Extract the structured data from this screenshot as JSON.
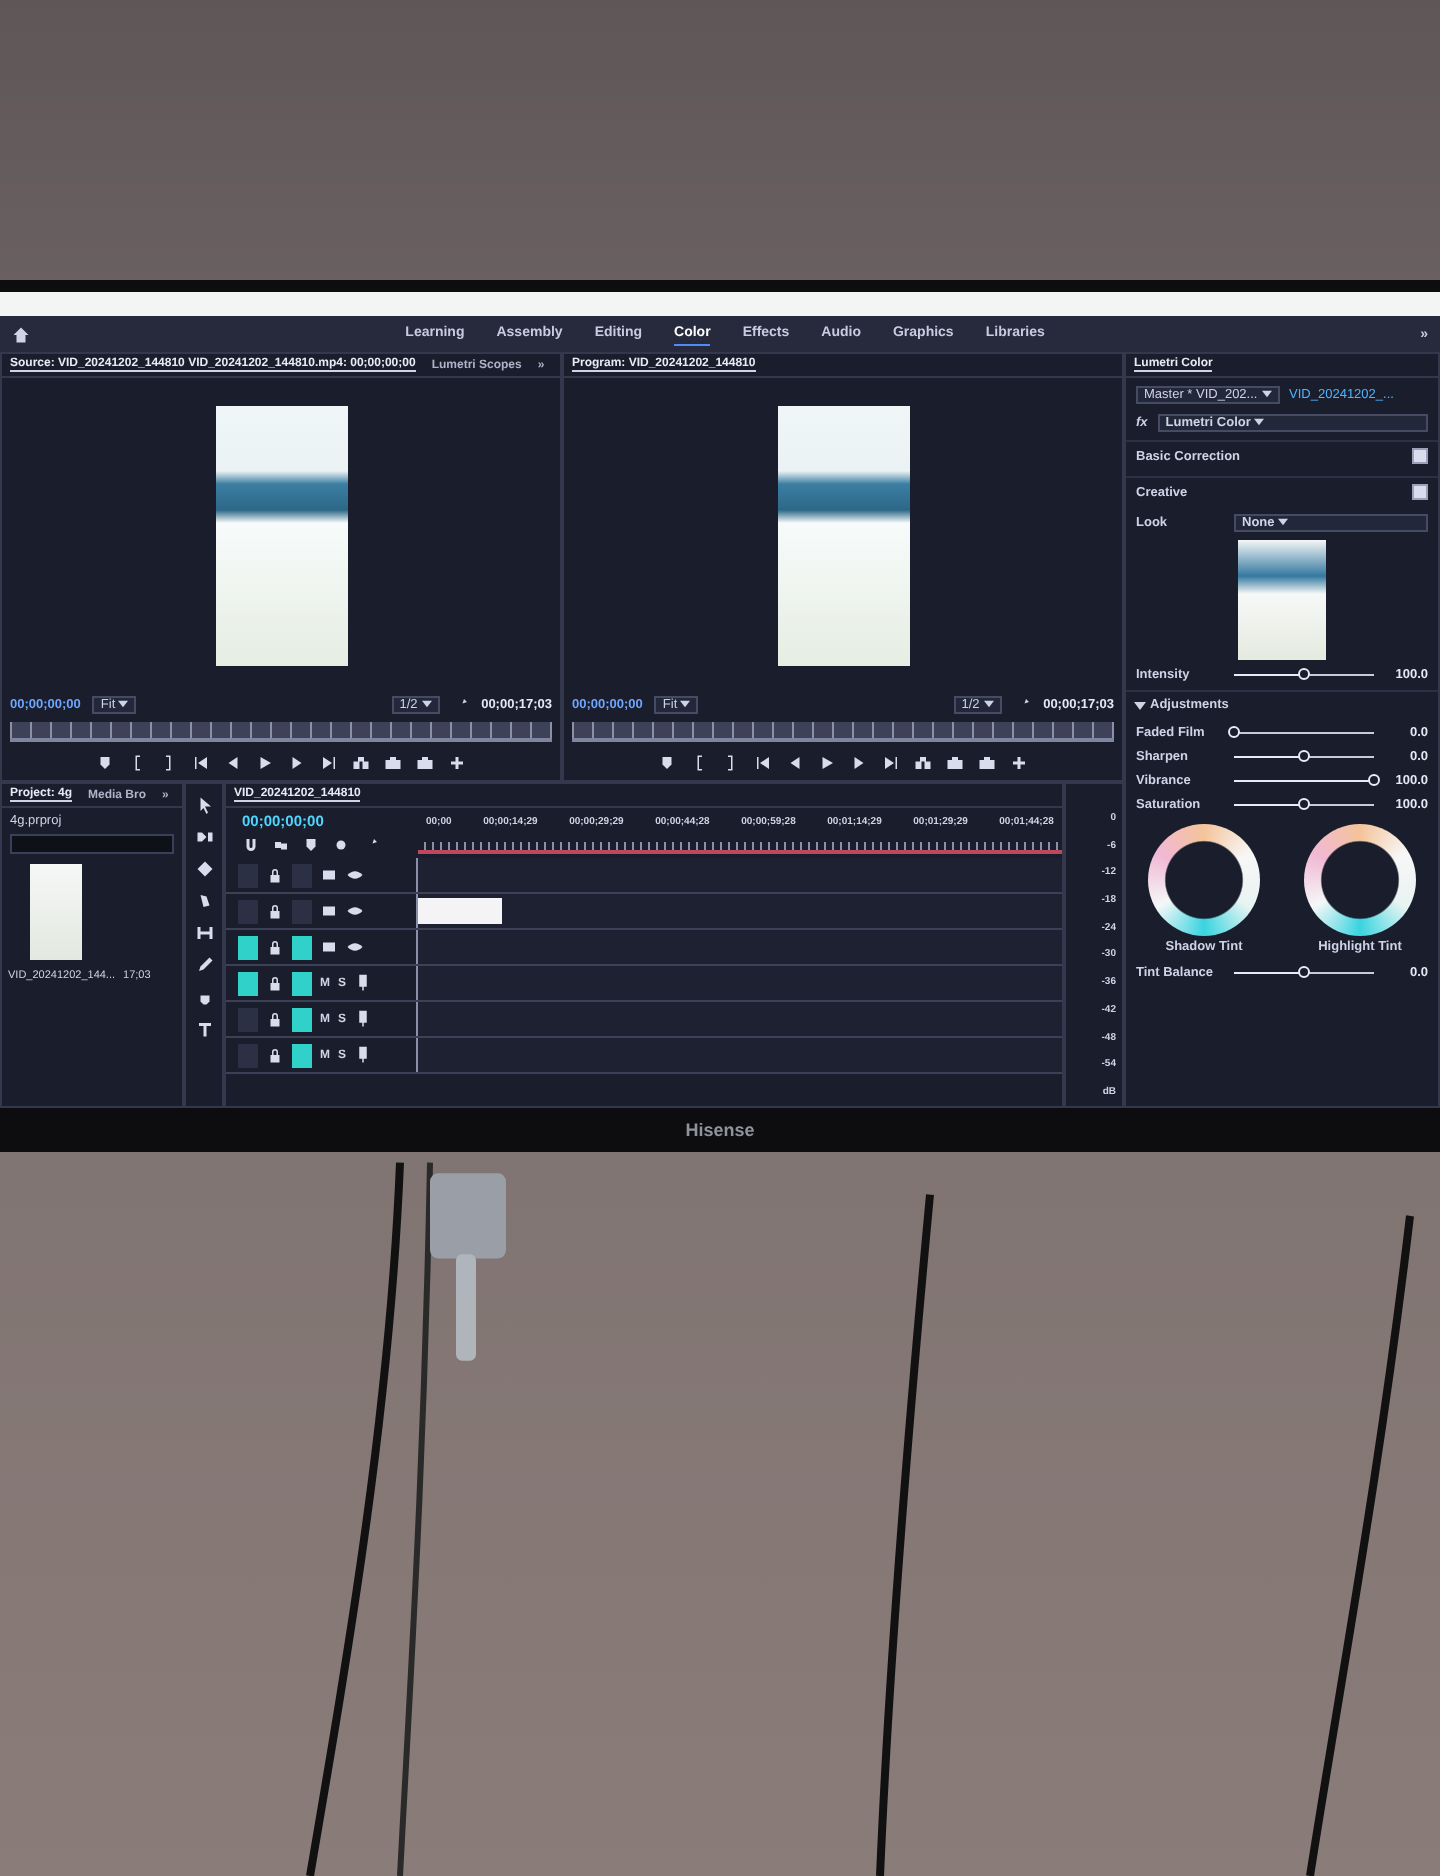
{
  "tv": {
    "brand": "Hisense"
  },
  "workspaces": [
    {
      "label": "Learning",
      "selected": false
    },
    {
      "label": "Assembly",
      "selected": false
    },
    {
      "label": "Editing",
      "selected": false
    },
    {
      "label": "Color",
      "selected": true
    },
    {
      "label": "Effects",
      "selected": false
    },
    {
      "label": "Audio",
      "selected": false
    },
    {
      "label": "Graphics",
      "selected": false
    },
    {
      "label": "Libraries",
      "selected": false
    }
  ],
  "workspace_overflow": "»",
  "source_monitor": {
    "tabs": [
      {
        "label": "Source: VID_20241202_144810 VID_20241202_144810.mp4: 00;00;00;00",
        "selected": true
      },
      {
        "label": "Lumetri Scopes",
        "selected": false
      }
    ],
    "overflow": "»",
    "timecode": "00;00;00;00",
    "zoom": "Fit",
    "resolution": "1/2",
    "duration": "00;00;17;03"
  },
  "program_monitor": {
    "tabs": [
      {
        "label": "Program: VID_20241202_144810",
        "selected": true
      }
    ],
    "timecode": "00;00;00;00",
    "zoom": "Fit",
    "resolution": "1/2",
    "duration": "00;00;17;03"
  },
  "project_panel": {
    "tabs": [
      {
        "label": "Project: 4g",
        "selected": true
      },
      {
        "label": "Media Bro",
        "selected": false
      }
    ],
    "overflow": "»",
    "file": "4g.prproj",
    "clip_name": "VID_20241202_144...",
    "clip_duration": "17;03"
  },
  "timeline": {
    "title": "VID_20241202_144810",
    "timecode": "00;00;00;00",
    "ruler": [
      "00;00",
      "00;00;14;29",
      "00;00;29;29",
      "00;00;44;28",
      "00;00;59;28",
      "00;01;14;29",
      "00;01;29;29",
      "00;01;44;28"
    ],
    "tracks": [
      {
        "kind": "video",
        "source_patched": false,
        "targeted": false,
        "has_clip": false
      },
      {
        "kind": "video",
        "source_patched": false,
        "targeted": false,
        "has_clip": true
      },
      {
        "kind": "video",
        "source_patched": true,
        "targeted": true,
        "has_clip": false
      },
      {
        "kind": "audio",
        "source_patched": true,
        "targeted": true,
        "has_clip": false,
        "mute": "M",
        "solo": "S"
      },
      {
        "kind": "audio",
        "source_patched": false,
        "targeted": true,
        "has_clip": false,
        "mute": "M",
        "solo": "S"
      },
      {
        "kind": "audio",
        "source_patched": false,
        "targeted": true,
        "has_clip": false,
        "mute": "M",
        "solo": "S"
      }
    ]
  },
  "audio_meter": {
    "scale": [
      "0",
      "-6",
      "-12",
      "-18",
      "-24",
      "-30",
      "-36",
      "-42",
      "-48",
      "-54",
      "dB"
    ]
  },
  "lumetri": {
    "title": "Lumetri Color",
    "master": "Master * VID_202...",
    "clip": "VID_20241202_...",
    "fx": "fx",
    "effect": "Lumetri Color",
    "basic_correction": {
      "label": "Basic Correction",
      "checked": true
    },
    "creative": {
      "label": "Creative",
      "checked": true
    },
    "look_label": "Look",
    "look_value": "None",
    "intensity": {
      "label": "Intensity",
      "value": "100.0",
      "level": 0.5
    },
    "adjustments": {
      "label": "Adjustments",
      "expanded": true,
      "sliders": [
        {
          "label": "Faded Film",
          "value": "0.0",
          "level": 0
        },
        {
          "label": "Sharpen",
          "value": "0.0",
          "level": 0.5
        },
        {
          "label": "Vibrance",
          "value": "100.0",
          "level": 1
        },
        {
          "label": "Saturation",
          "value": "100.0",
          "level": 0.5
        }
      ],
      "wheels": [
        {
          "label": "Shadow Tint"
        },
        {
          "label": "Highlight Tint"
        }
      ],
      "tint_balance": {
        "label": "Tint Balance",
        "value": "0.0",
        "level": 0.5
      }
    }
  }
}
